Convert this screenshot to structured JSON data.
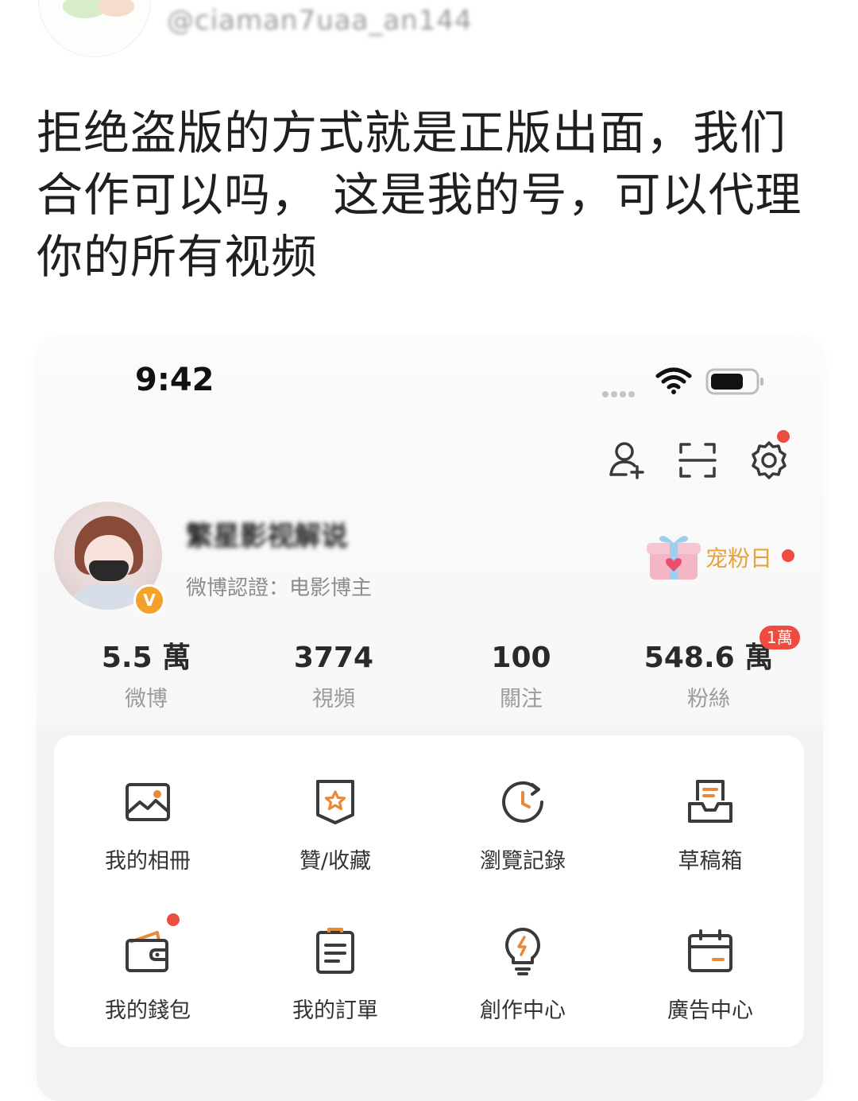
{
  "post": {
    "handle": "@ciaman7uaa_an144",
    "text": "拒绝盗版的方式就是正版出面，我们合作可以吗， 这是我的号，可以代理你的所有视频"
  },
  "status_bar": {
    "time": "9:42"
  },
  "profile": {
    "name": "繁星影视解说",
    "certification": "微博認證：电影博主",
    "verified_mark": "V",
    "fan_day_label": "宠粉日"
  },
  "stats": [
    {
      "value": "5.5 萬",
      "label": "微博"
    },
    {
      "value": "3774",
      "label": "視頻"
    },
    {
      "value": "100",
      "label": "關注"
    },
    {
      "value": "548.6 萬",
      "label": "粉絲",
      "badge": "1萬"
    }
  ],
  "menu": [
    {
      "label": "我的相冊",
      "icon": "photo-album-icon"
    },
    {
      "label": "贊/收藏",
      "icon": "favorites-icon"
    },
    {
      "label": "瀏覽記錄",
      "icon": "history-icon"
    },
    {
      "label": "草稿箱",
      "icon": "drafts-icon"
    },
    {
      "label": "我的錢包",
      "icon": "wallet-icon"
    },
    {
      "label": "我的訂單",
      "icon": "orders-icon"
    },
    {
      "label": "創作中心",
      "icon": "creator-center-icon"
    },
    {
      "label": "廣告中心",
      "icon": "ad-center-icon"
    }
  ],
  "colors": {
    "accent_orange": "#e8893a",
    "icon_dark": "#3a3a3a",
    "badge_red": "#ef4b3f",
    "fan_day": "#e6a33b"
  }
}
